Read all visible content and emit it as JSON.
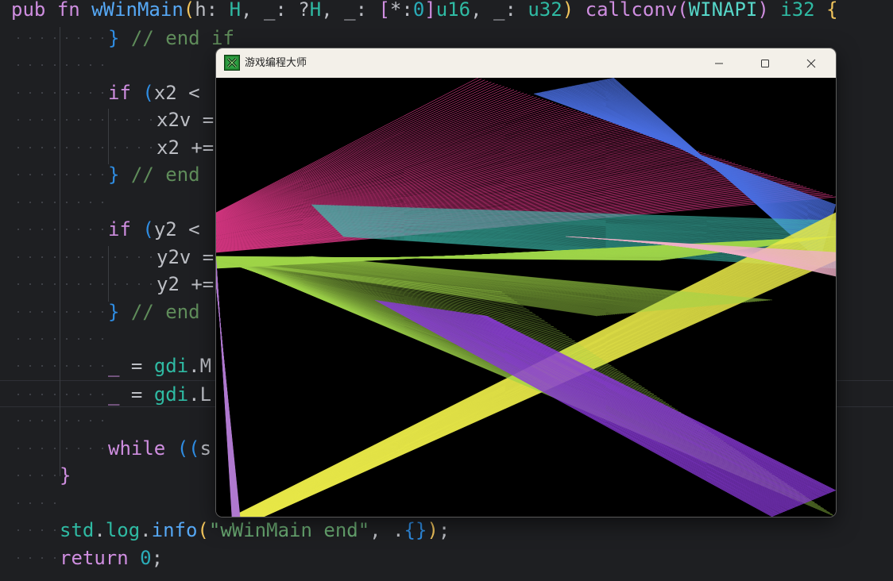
{
  "editor": {
    "lines": [
      {
        "tokens": [
          [
            "kw",
            "pub"
          ],
          [
            "plain",
            " "
          ],
          [
            "kw",
            "fn"
          ],
          [
            "plain",
            " "
          ],
          [
            "fn",
            "wWinMain"
          ],
          [
            "p1",
            "("
          ],
          [
            "plain",
            "h"
          ],
          [
            "plain",
            ": "
          ],
          [
            "ty",
            "H"
          ],
          [
            "plain",
            ", "
          ],
          [
            "plain",
            "_"
          ],
          [
            "plain",
            ": ?"
          ],
          [
            "ty",
            "H"
          ],
          [
            "plain",
            ", "
          ],
          [
            "plain",
            "_"
          ],
          [
            "plain",
            ": "
          ],
          [
            "p2",
            "["
          ],
          [
            "plain",
            "*:"
          ],
          [
            "num",
            "0"
          ],
          [
            "p2",
            "]"
          ],
          [
            "ty",
            "u16"
          ],
          [
            "plain",
            ", "
          ],
          [
            "plain",
            "_"
          ],
          [
            "plain",
            ": "
          ],
          [
            "ty",
            "u32"
          ],
          [
            "p1",
            ")"
          ],
          [
            "plain",
            " "
          ],
          [
            "kw",
            "callconv"
          ],
          [
            "p2",
            "("
          ],
          [
            "ids",
            "WINAPI"
          ],
          [
            "p2",
            ")"
          ],
          [
            "plain",
            " "
          ],
          [
            "ty",
            "i32"
          ],
          [
            "plain",
            " "
          ],
          [
            "p1",
            "{"
          ]
        ]
      },
      {
        "tokens": [
          [
            "p3",
            "}"
          ],
          [
            "plain",
            " "
          ],
          [
            "cm",
            "// end if"
          ]
        ]
      },
      {
        "tokens": []
      },
      {
        "tokens": [
          [
            "kw",
            "if"
          ],
          [
            "plain",
            " "
          ],
          [
            "p3",
            "("
          ],
          [
            "plain",
            "x2 <"
          ]
        ]
      },
      {
        "tokens": [
          [
            "plain",
            "x2v ="
          ]
        ]
      },
      {
        "tokens": [
          [
            "plain",
            "x2 +="
          ]
        ]
      },
      {
        "tokens": [
          [
            "p3",
            "}"
          ],
          [
            "plain",
            " "
          ],
          [
            "cm",
            "// end"
          ]
        ]
      },
      {
        "tokens": []
      },
      {
        "tokens": [
          [
            "kw",
            "if"
          ],
          [
            "plain",
            " "
          ],
          [
            "p3",
            "("
          ],
          [
            "plain",
            "y2 <"
          ]
        ]
      },
      {
        "tokens": [
          [
            "plain",
            "y2v ="
          ]
        ]
      },
      {
        "tokens": [
          [
            "plain",
            "y2 +="
          ]
        ]
      },
      {
        "tokens": [
          [
            "p3",
            "}"
          ],
          [
            "plain",
            " "
          ],
          [
            "cm",
            "// end"
          ]
        ]
      },
      {
        "tokens": []
      },
      {
        "tokens": [
          [
            "kw",
            "_"
          ],
          [
            "plain",
            " = "
          ],
          [
            "ty",
            "gdi"
          ],
          [
            "plain",
            "."
          ],
          [
            "plain",
            "M"
          ]
        ]
      },
      {
        "tokens": [
          [
            "kw",
            "_"
          ],
          [
            "plain",
            " = "
          ],
          [
            "ty",
            "gdi"
          ],
          [
            "plain",
            "."
          ],
          [
            "plain",
            "L"
          ]
        ]
      },
      {
        "tokens": []
      },
      {
        "tokens": [
          [
            "kw",
            "while"
          ],
          [
            "plain",
            " "
          ],
          [
            "p3",
            "(("
          ],
          [
            "plain",
            "s"
          ]
        ]
      },
      {
        "tokens": [
          [
            "p2",
            "}"
          ]
        ]
      },
      {
        "tokens": []
      },
      {
        "tokens": [
          [
            "ty",
            "std"
          ],
          [
            "plain",
            "."
          ],
          [
            "ty",
            "log"
          ],
          [
            "plain",
            "."
          ],
          [
            "fn",
            "info"
          ],
          [
            "p1",
            "("
          ],
          [
            "str",
            "\"wWinMain end\""
          ],
          [
            "plain",
            ", ."
          ],
          [
            "p3",
            "{}"
          ],
          [
            "p1",
            ")"
          ],
          [
            "plain",
            ";"
          ]
        ]
      },
      {
        "tokens": [
          [
            "kw",
            "return"
          ],
          [
            "plain",
            " "
          ],
          [
            "num",
            "0"
          ],
          [
            "plain",
            ";"
          ]
        ]
      }
    ]
  },
  "window": {
    "title": "游戏编程大师",
    "app_icon": "game-app-icon",
    "controls": [
      {
        "name": "minimize",
        "icon": "minimize-icon"
      },
      {
        "name": "maximize",
        "icon": "maximize-icon"
      },
      {
        "name": "close",
        "icon": "close-icon"
      }
    ]
  },
  "canvas": {
    "background": "#000000",
    "colors": [
      "#e23a8a",
      "#4a6ee0",
      "#40c0b0",
      "#9fd44a",
      "#e8e84a",
      "#8a3ad8",
      "#b07ad0",
      "#f0b0c8",
      "#ffffff"
    ]
  }
}
